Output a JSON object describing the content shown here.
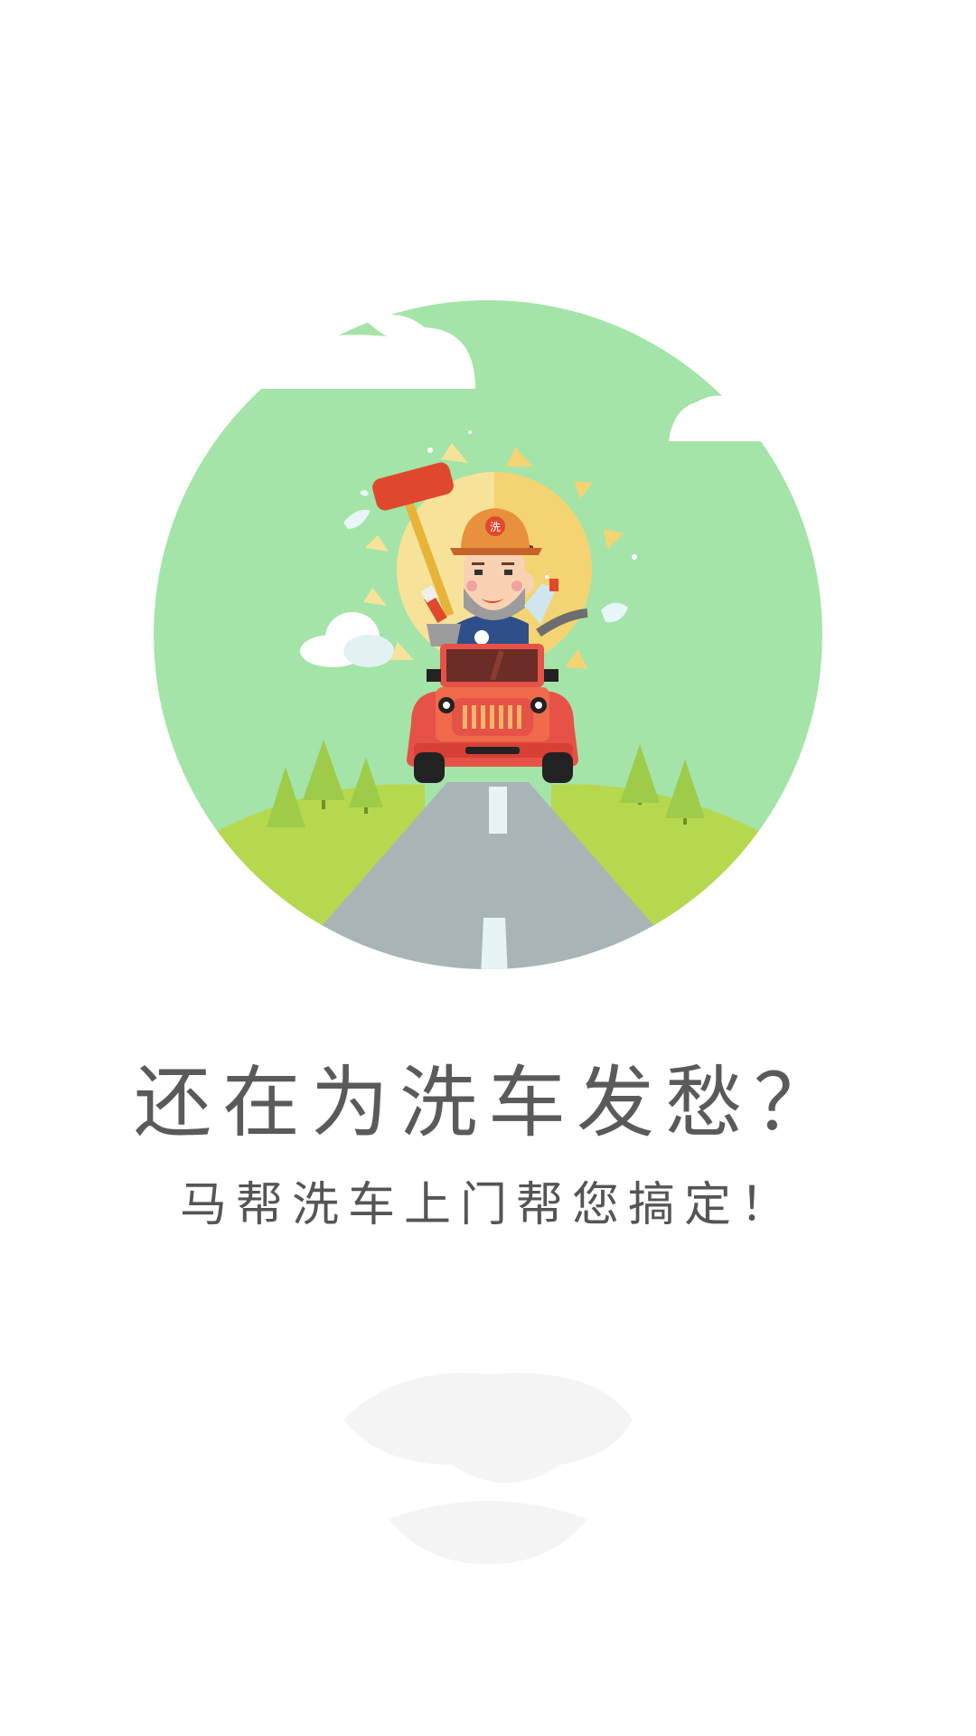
{
  "splash": {
    "headline": "还在为洗车发愁？",
    "subline": "马帮洗车上门帮您搞定！",
    "cap_badge": "洗"
  },
  "icons": {
    "hero": "car-wash-illustration",
    "watermark": "mabang-logo-watermark"
  },
  "colors": {
    "background": "#ffffff",
    "circle": "#a4e4a8",
    "hill": "#b6d84e",
    "road": "#a9b4b7",
    "car": "#e65247",
    "sun": "#f4d373",
    "text": "#5a5a5a"
  }
}
